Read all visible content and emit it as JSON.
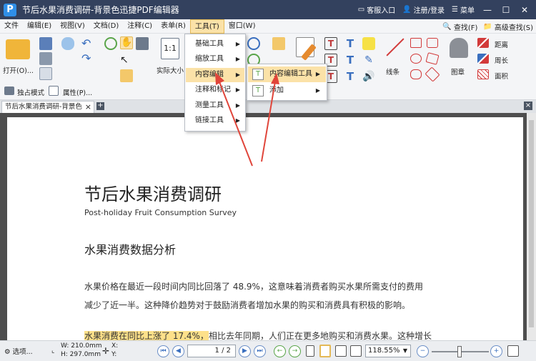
{
  "app": {
    "logo": "P",
    "title": "节后水果消费调研-背景色迅捷PDF编辑器"
  },
  "titlebar": {
    "service": "客服入口",
    "login": "注册/登录",
    "menu": "菜单"
  },
  "menubar": {
    "items": [
      "文件",
      "编辑(E)",
      "视图(V)",
      "文档(D)",
      "注释(C)",
      "表单(R)",
      "工具(T)",
      "窗口(W)"
    ],
    "find": "查找(F)",
    "advanced_find": "高级查找(S)"
  },
  "toolbar": {
    "open": "打开(O)...",
    "actual_size": "实际大小",
    "line": "线条",
    "stamp": "图章",
    "distance": "距离",
    "perimeter": "周长",
    "area": "面积",
    "exclusive": "独占模式",
    "properties": "属性(P)..."
  },
  "tabs": {
    "doc_tab": "节后水果消费调研-背景色"
  },
  "dropdown": {
    "items": [
      "基础工具",
      "缩放工具",
      "内容编辑",
      "注释和标记",
      "测量工具",
      "链接工具"
    ],
    "selected": 2
  },
  "submenu": {
    "items": [
      "内容编辑工具",
      "添加"
    ],
    "selected": 0
  },
  "document": {
    "title": "节后水果消费调研",
    "subtitle": "Post-holiday Fruit Consumption Survey",
    "heading": "水果消费数据分析",
    "para1_line1": "水果价格在最近一段时间内同比回落了  48.9%，这意味着消费者购买水果所需支付的费用",
    "para1_line2": "减少了近一半。这种降价趋势对于鼓励消费者增加水果的购买和消费具有积极的影响。",
    "para2_highlight": "水果消费在同比上涨了 17.4%，",
    "para2_rest": "相比去年同期，人们正在更多地购买和消费水果。这种增长"
  },
  "statusbar": {
    "options": "选项...",
    "width": "W: 210.0mm",
    "height": "H: 297.0mm",
    "x": "X:",
    "y": "Y:",
    "page": "1 / 2",
    "zoom": "118.55%"
  },
  "colors": {
    "titlebar": "#33415e",
    "highlight": "#fde08a",
    "arrow": "#e0453a"
  }
}
